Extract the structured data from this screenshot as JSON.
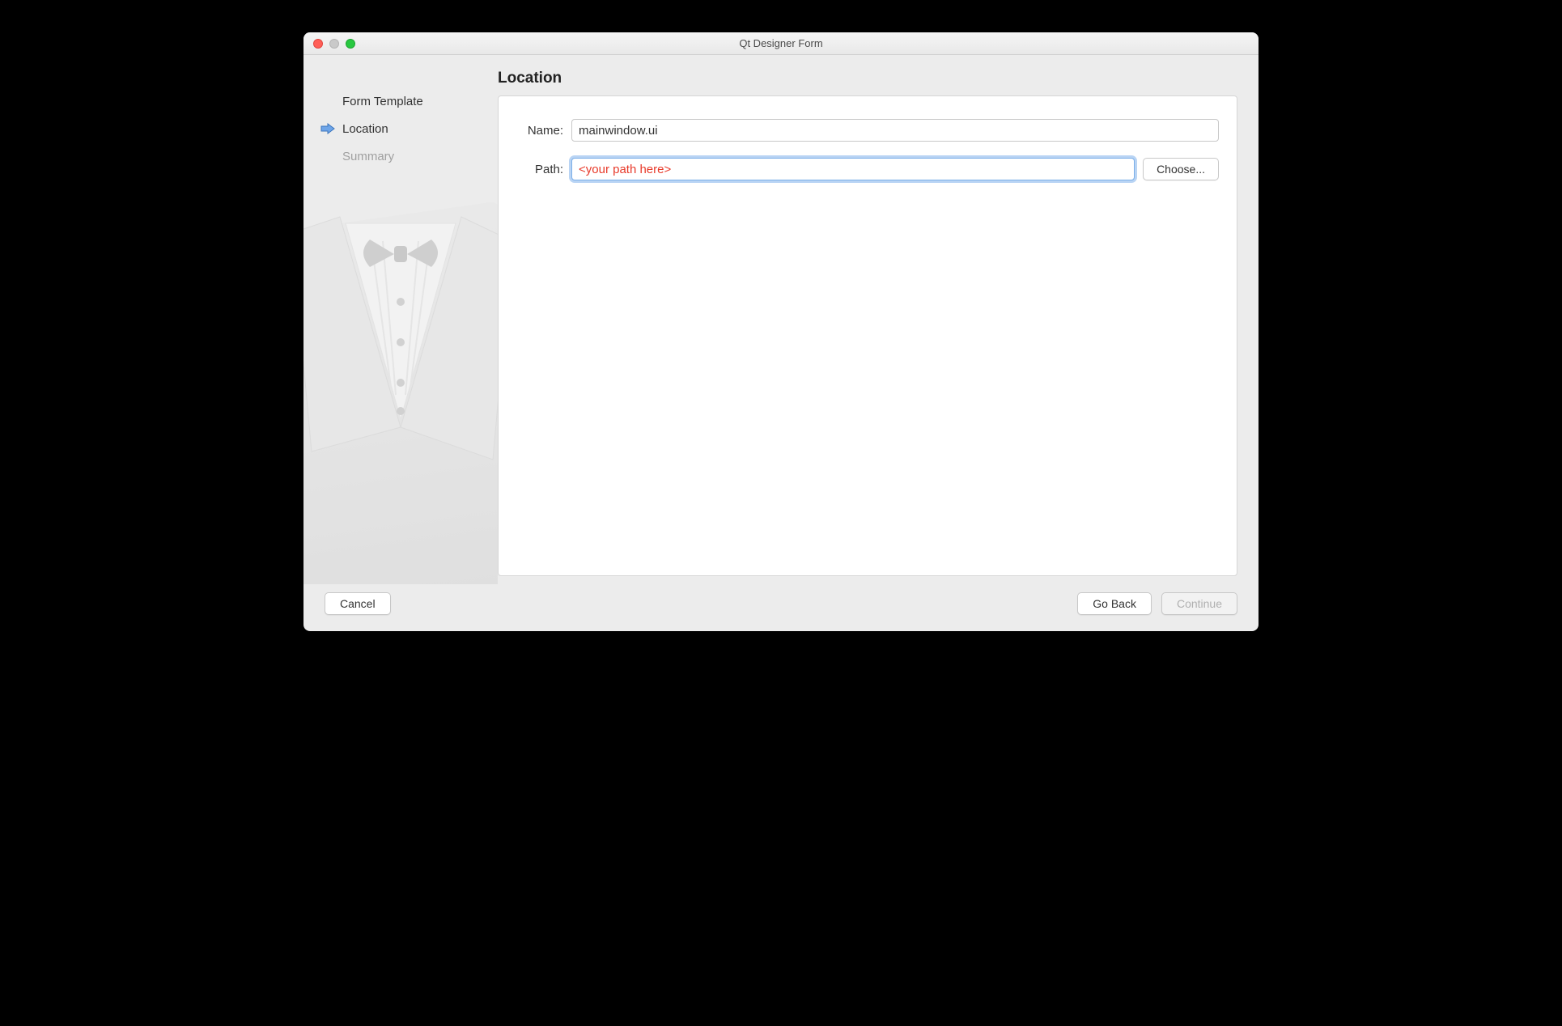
{
  "window": {
    "title": "Qt Designer Form"
  },
  "sidebar": {
    "steps": [
      {
        "label": "Form Template"
      },
      {
        "label": "Location"
      },
      {
        "label": "Summary"
      }
    ]
  },
  "page": {
    "title": "Location",
    "name_label": "Name:",
    "name_value": "mainwindow.ui",
    "path_label": "Path:",
    "path_value": "<your path here>",
    "choose_label": "Choose..."
  },
  "buttons": {
    "cancel": "Cancel",
    "go_back": "Go Back",
    "continue": "Continue"
  }
}
